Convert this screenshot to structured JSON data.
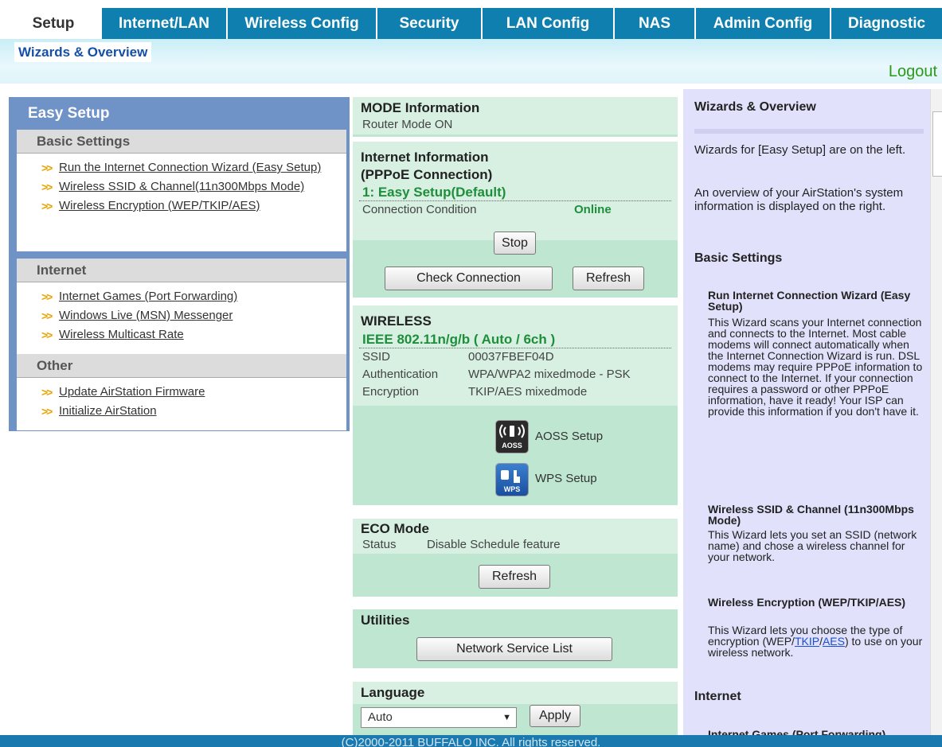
{
  "tabs": [
    "Setup",
    "Internet/LAN",
    "Wireless Config",
    "Security",
    "LAN Config",
    "NAS",
    "Admin Config",
    "Diagnostic"
  ],
  "subtab": "Wizards & Overview",
  "logout": "Logout",
  "left": {
    "title": "Easy Setup",
    "sections": [
      {
        "header": "Basic Settings",
        "items": [
          "Run the Internet Connection Wizard (Easy Setup)",
          "Wireless SSID & Channel(11n300Mbps Mode)",
          "Wireless Encryption (WEP/TKIP/AES)"
        ]
      },
      {
        "header": "Internet",
        "items": [
          "Internet Games (Port Forwarding)",
          "Windows Live (MSN) Messenger",
          "Wireless Multicast Rate"
        ]
      },
      {
        "header": "Other",
        "items": [
          "Update AirStation Firmware",
          "Initialize AirStation"
        ]
      }
    ]
  },
  "mode": {
    "title": "MODE Information",
    "status": "Router Mode ON"
  },
  "internet": {
    "title1": "Internet Information",
    "title2": "(PPPoE Connection)",
    "profile": "1: Easy Setup(Default)",
    "cond_label": "Connection Condition",
    "cond_value": "Online",
    "stop": "Stop",
    "check": "Check Connection",
    "refresh": "Refresh"
  },
  "wireless": {
    "title": "WIRELESS",
    "standard": "IEEE 802.11n/g/b ( Auto / 6ch )",
    "ssid_label": "SSID",
    "ssid": "00037FBEF04D",
    "auth_label": "Authentication",
    "auth": "WPA/WPA2 mixedmode - PSK",
    "enc_label": "Encryption",
    "enc": "TKIP/AES mixedmode",
    "aoss": "AOSS Setup",
    "aoss_icon_text": "AOSS",
    "wps": "WPS Setup",
    "wps_icon_text": "WPS"
  },
  "eco": {
    "title": "ECO Mode",
    "status_label": "Status",
    "status": "Disable Schedule feature",
    "refresh": "Refresh"
  },
  "utilities": {
    "title": "Utilities",
    "button": "Network Service List"
  },
  "language": {
    "title": "Language",
    "selected": "Auto",
    "apply": "Apply"
  },
  "right": {
    "title": "Wizards & Overview",
    "p1": "Wizards for [Easy Setup] are on the left.",
    "p2": "An overview of your AirStation's system information is displayed on the right.",
    "basic": "Basic Settings",
    "h1": "Run Internet Connection Wizard (Easy Setup)",
    "d1": "This Wizard scans your Internet connection and connects to the Internet. Most cable modems will connect automatically when the Internet Connection Wizard is run. DSL modems may require PPPoE information to connect to the Internet. If your connection requires a password or other PPPoE information, have it ready! Your ISP can provide this information if you don't have it.",
    "h2": "Wireless SSID & Channel (11n300Mbps Mode)",
    "d2": "This Wizard lets you set an SSID (network name) and chose a wireless channel for your network.",
    "h3": "Wireless Encryption (WEP/TKIP/AES)",
    "d3a": "This Wizard lets you choose the type of encryption (WEP/",
    "d3_tkip": "TKIP",
    "d3_slash": "/",
    "d3_aes": "AES",
    "d3b": ") to use on your wireless network.",
    "internet": "Internet",
    "h4": "Internet Games (Port Forwarding)"
  },
  "footer": "(C)2000-2011 BUFFALO INC. All rights reserved."
}
